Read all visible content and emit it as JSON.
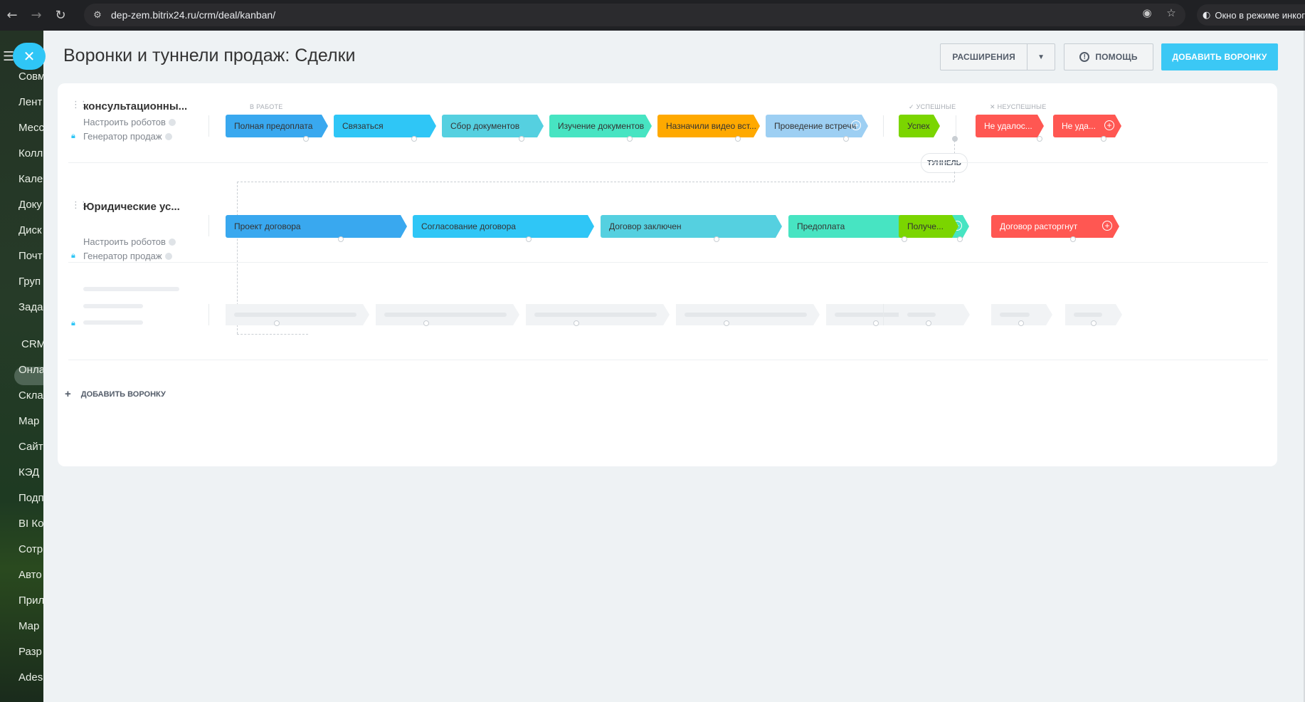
{
  "browser": {
    "url": "dep-zem.bitrix24.ru/crm/deal/kanban/",
    "incognito_label": "Окно в режиме инког"
  },
  "sidebar": {
    "items": [
      "Совм",
      "Лент",
      "Месс",
      "Колл",
      "Кале",
      "Доку",
      "Диск",
      "Почт",
      "Груп",
      "Зада",
      "CRM",
      "Онла",
      "Скла",
      "Мар",
      "Сайт",
      "КЭД",
      "Подп",
      "BI Ко",
      "Сотр",
      "Авто",
      "Прил",
      "Мар",
      "Разр",
      "Ades"
    ]
  },
  "header": {
    "title": "Воронки и туннели продаж: Сделки",
    "extensions_label": "РАСШИРЕНИЯ",
    "help_label": "ПОМОЩЬ",
    "add_funnel_label": "ДОБАВИТЬ ВОРОНКУ"
  },
  "columns": {
    "in_work": "В РАБОТЕ",
    "success": "УСПЕШНЫЕ",
    "fail": "НЕУСПЕШНЫЕ"
  },
  "funnels": [
    {
      "name": "консультационны...",
      "robots_label": "Настроить роботов",
      "generator_label": "Генератор продаж",
      "stages": [
        {
          "label": "Полная предоплата",
          "color": "#39a8ef"
        },
        {
          "label": "Связаться",
          "color": "#2fc6f6"
        },
        {
          "label": "Сбор документов",
          "color": "#55d0e0"
        },
        {
          "label": "Изучение документов",
          "color": "#47e4c2"
        },
        {
          "label": "Назначили видео вст...",
          "color": "#ffa900"
        },
        {
          "label": "Проведение встречи",
          "color": "#9dcff3"
        }
      ],
      "success": [
        {
          "label": "Успех",
          "color": "#7bd500"
        }
      ],
      "fail": [
        {
          "label": "Не удалос...",
          "color": "#ff5752"
        },
        {
          "label": "Не уда...",
          "color": "#ff5752"
        }
      ]
    },
    {
      "name": "Юридические ус...",
      "robots_label": "Настроить роботов",
      "generator_label": "Генератор продаж",
      "stages": [
        {
          "label": "Проект договора",
          "color": "#39a8ef"
        },
        {
          "label": "Согласование договора",
          "color": "#2fc6f6"
        },
        {
          "label": "Договор заключен",
          "color": "#55d0e0"
        },
        {
          "label": "Предоплата",
          "color": "#47e4c2"
        }
      ],
      "success": [
        {
          "label": "Получе...",
          "color": "#7bd500"
        }
      ],
      "fail": [
        {
          "label": "Договор расторгнут",
          "color": "#ff5752"
        }
      ]
    }
  ],
  "tunnel_label": "ТУННЕЛЬ",
  "footer": {
    "add_funnel_label": "ДОБАВИТЬ ВОРОНКУ"
  }
}
